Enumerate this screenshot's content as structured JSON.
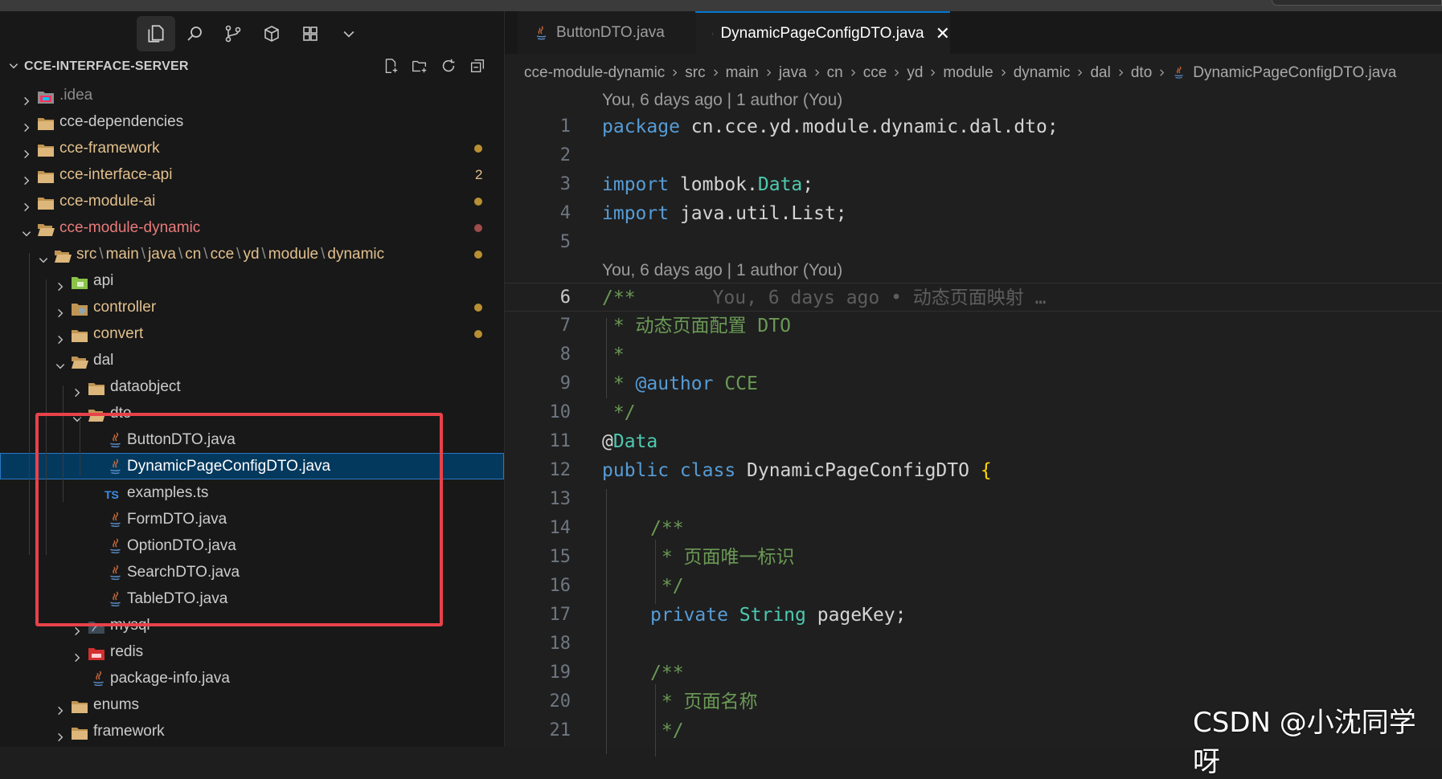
{
  "colors": {
    "selection_bg": "#04395e",
    "highlight_box": "#e8424a",
    "modified_dot": "#b89032",
    "error_dot": "#9e4c4c",
    "accent": "#0078d4"
  },
  "activity_icons": [
    "explorer-icon",
    "search-icon",
    "source-control-icon",
    "extensions-icon",
    "remote-explorer-icon",
    "chevron-down-icon"
  ],
  "explorer": {
    "title": "CCE-INTERFACE-SERVER",
    "toolbar_icons": [
      "new-file-icon",
      "new-folder-icon",
      "refresh-icon",
      "collapse-all-icon"
    ],
    "items": [
      {
        "label": ".idea"
      },
      {
        "label": "cce-dependencies"
      },
      {
        "label": "cce-framework"
      },
      {
        "label": "cce-interface-api",
        "badge": "2"
      },
      {
        "label": "cce-module-ai"
      },
      {
        "label": "cce-module-dynamic"
      },
      {
        "label_parts": [
          "src",
          "main",
          "java",
          "cn",
          "cce",
          "yd",
          "module",
          "dynamic"
        ],
        "sep": "\\"
      },
      {
        "label": "api"
      },
      {
        "label": "controller"
      },
      {
        "label": "convert"
      },
      {
        "label": "dal"
      },
      {
        "label": "dataobject"
      },
      {
        "label": "dto"
      },
      {
        "label": "ButtonDTO.java"
      },
      {
        "label": "DynamicPageConfigDTO.java",
        "selected": true
      },
      {
        "label": "examples.ts",
        "icon_text": "TS"
      },
      {
        "label": "FormDTO.java"
      },
      {
        "label": "OptionDTO.java"
      },
      {
        "label": "SearchDTO.java"
      },
      {
        "label": "TableDTO.java"
      },
      {
        "label": "mysql"
      },
      {
        "label": "redis"
      },
      {
        "label": "package-info.java"
      },
      {
        "label": "enums"
      },
      {
        "label": "framework"
      }
    ]
  },
  "tabs": [
    {
      "label": "ButtonDTO.java",
      "active": false
    },
    {
      "label": "DynamicPageConfigDTO.java",
      "active": true,
      "close": "✕"
    }
  ],
  "breadcrumb": [
    "cce-module-dynamic",
    "src",
    "main",
    "java",
    "cn",
    "cce",
    "yd",
    "module",
    "dynamic",
    "dal",
    "dto",
    "DynamicPageConfigDTO.java"
  ],
  "codelens": [
    "You, 6 days ago | 1 author (You)",
    "You, 6 days ago | 1 author (You)"
  ],
  "code": {
    "line_numbers": [
      "1",
      "2",
      "3",
      "4",
      "5",
      "6",
      "7",
      "8",
      "9",
      "10",
      "11",
      "12",
      "13",
      "14",
      "15",
      "16",
      "17",
      "18",
      "19",
      "20",
      "21"
    ],
    "l1": {
      "kw": "package",
      "rest": " cn.cce.yd.module.dynamic.dal.dto;"
    },
    "l3": {
      "kw": "import",
      "a": " lombok.",
      "ty": "Data",
      "b": ";"
    },
    "l4": {
      "kw": "import",
      "a": " java.util.List;"
    },
    "l6": {
      "cm": "/**",
      "blame": "You, 6 days ago • 动态页面映射 …"
    },
    "l7": {
      "cm": " * 动态页面配置 DTO"
    },
    "l8": {
      "cm": " *"
    },
    "l9": {
      "cm": " * ",
      "tag": "@author",
      "rest": " CCE"
    },
    "l10": {
      "cm": " */"
    },
    "l11": {
      "at": "@",
      "ty": "Data"
    },
    "l12": {
      "kw": "public class",
      "name": " DynamicPageConfigDTO ",
      "br": "{"
    },
    "l14": {
      "cm": "/**"
    },
    "l15": {
      "cm": " * 页面唯一标识"
    },
    "l16": {
      "cm": " */"
    },
    "l17": {
      "kw": "private",
      "ty": " String",
      "rest": " pageKey;"
    },
    "l19": {
      "cm": "/**"
    },
    "l20": {
      "cm": " * 页面名称"
    },
    "l21": {
      "cm": " */"
    }
  },
  "watermark": "CSDN @小沈同学呀"
}
